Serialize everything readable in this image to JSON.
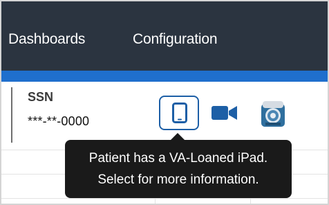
{
  "nav": {
    "items": [
      {
        "label": "Dashboards"
      },
      {
        "label": "Configuration"
      }
    ],
    "colors": {
      "bar": "#2b3440",
      "accent": "#1f6fcd"
    }
  },
  "patient": {
    "ssn_label": "SSN",
    "ssn_value": "***-**-0000"
  },
  "actions": {
    "ipad_icon": "tablet-icon",
    "video_icon": "video-camera-icon",
    "va_icon": "va-seal-icon",
    "accent_color": "#1d5fa6"
  },
  "tooltip": {
    "line1": "Patient has a VA-Loaned iPad.",
    "line2": "Select for more information."
  }
}
